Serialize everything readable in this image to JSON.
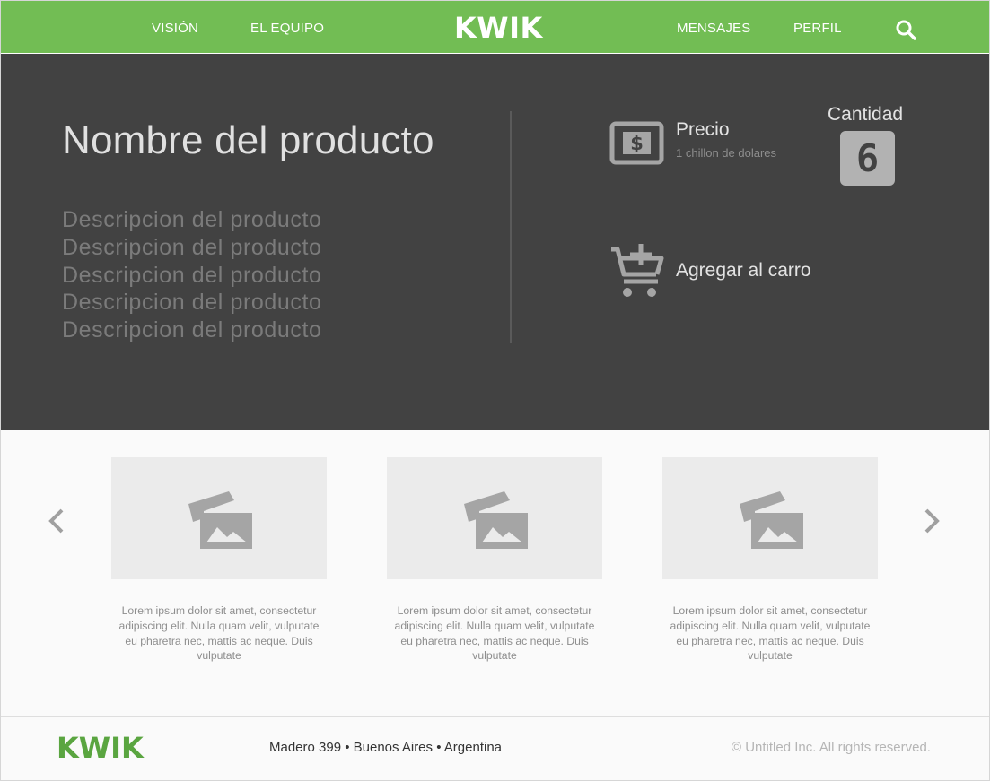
{
  "header": {
    "nav_left": [
      "VISIÓN",
      "EL EQUIPO"
    ],
    "logo": "KWIK",
    "nav_right": [
      "MENSAJES",
      "PERFIL"
    ],
    "search_icon": "search-icon",
    "bg_color": "#72bd54"
  },
  "product": {
    "title": "Nombre del producto",
    "description_lines": [
      "Descripcion del producto",
      "Descripcion del producto",
      "Descripcion del producto",
      "Descripcion del producto",
      "Descripcion del producto"
    ],
    "price_label": "Precio",
    "price_value": "1 chillon de dolares",
    "price_icon": "dollar-bill-icon",
    "quantity_label": "Cantidad",
    "quantity_value": "6",
    "cart_label": "Agregar al carro",
    "cart_icon": "add-to-cart-icon",
    "bg_color": "#424242"
  },
  "carousel": {
    "prev_icon": "chevron-left-icon",
    "next_icon": "chevron-right-icon",
    "cards": [
      {
        "image_icon": "image-placeholder-icon",
        "text": "Lorem ipsum dolor sit amet, consectetur adipiscing elit. Nulla quam velit, vulputate eu pharetra nec, mattis ac neque. Duis vulputate"
      },
      {
        "image_icon": "image-placeholder-icon",
        "text": "Lorem ipsum dolor sit amet, consectetur adipiscing elit. Nulla quam velit, vulputate eu pharetra nec, mattis ac neque. Duis vulputate"
      },
      {
        "image_icon": "image-placeholder-icon",
        "text": "Lorem ipsum dolor sit amet, consectetur adipiscing elit. Nulla quam velit, vulputate eu pharetra nec, mattis ac neque. Duis vulputate"
      }
    ]
  },
  "footer": {
    "logo": "KWIK",
    "address": "Madero 399 • Buenos Aires • Argentina",
    "copyright": "© Untitled Inc. All rights reserved.",
    "logo_color": "#5aa540"
  }
}
